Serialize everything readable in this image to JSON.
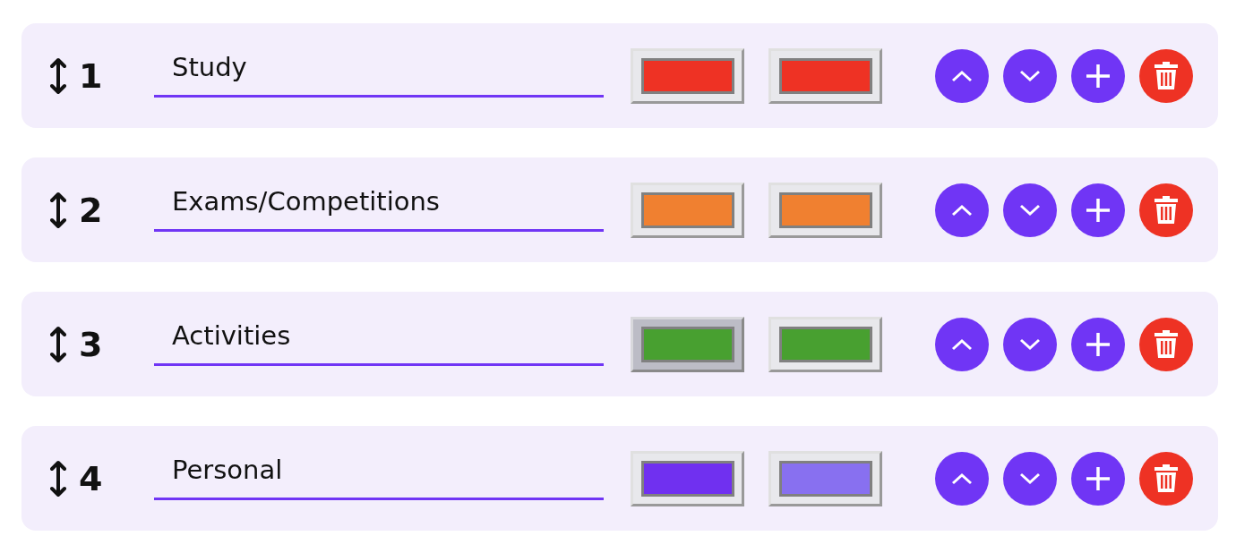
{
  "categories": [
    {
      "number": "1",
      "name": "Study",
      "colors": [
        {
          "color": "#ee3224",
          "pressed": false
        },
        {
          "color": "#ee3224",
          "pressed": false
        }
      ]
    },
    {
      "number": "2",
      "name": "Exams/Competitions",
      "colors": [
        {
          "color": "#f08030",
          "pressed": false
        },
        {
          "color": "#f08030",
          "pressed": false
        }
      ]
    },
    {
      "number": "3",
      "name": "Activities",
      "colors": [
        {
          "color": "#48a030",
          "pressed": true
        },
        {
          "color": "#48a030",
          "pressed": false
        }
      ]
    },
    {
      "number": "4",
      "name": "Personal",
      "colors": [
        {
          "color": "#7030f0",
          "pressed": false
        },
        {
          "color": "#8870f0",
          "pressed": false
        }
      ]
    }
  ]
}
